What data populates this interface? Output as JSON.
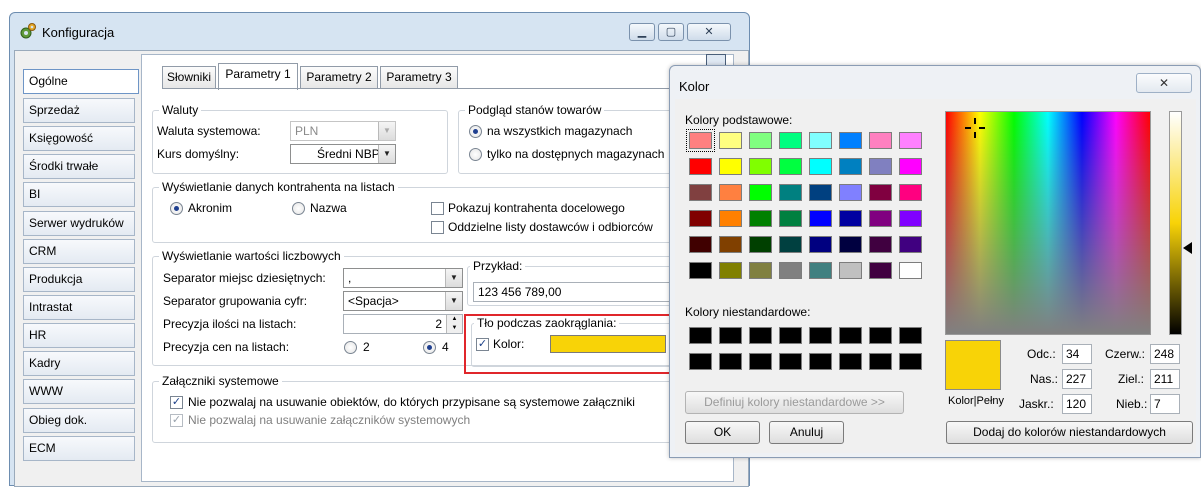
{
  "window": {
    "title": "Konfiguracja"
  },
  "nav": {
    "items": [
      "Ogólne",
      "Sprzedaż",
      "Księgowość",
      "Środki trwałe",
      "BI",
      "Serwer wydruków",
      "CRM",
      "Produkcja",
      "Intrastat",
      "HR",
      "Kadry",
      "WWW",
      "Obieg dok.",
      "ECM"
    ],
    "active": "Ogólne"
  },
  "tabs": [
    "Słowniki",
    "Parametry 1",
    "Parametry 2",
    "Parametry 3"
  ],
  "waluty": {
    "title": "Waluty",
    "system_label": "Waluta systemowa:",
    "system_value": "PLN",
    "course_label": "Kurs domyślny:",
    "course_value": "Średni NBP"
  },
  "stock_preview": {
    "title": "Podgląd stanów towarów",
    "opt_all": "na wszystkich magazynach",
    "opt_available": "tylko na dostępnych magazynach"
  },
  "contractor": {
    "title": "Wyświetlanie danych kontrahenta na listach",
    "opt_acronym": "Akronim",
    "opt_name": "Nazwa",
    "chk_target": "Pokazuj kontrahenta docelowego",
    "chk_separate": "Oddzielne listy dostawców i odbiorców"
  },
  "numbers": {
    "title": "Wyświetlanie wartości liczbowych",
    "decimal_label": "Separator miejsc dziesiętnych:",
    "decimal_value": ",",
    "group_label": "Separator grupowania cyfr:",
    "group_value": "<Spacja>",
    "qty_label": "Precyzja ilości na listach:",
    "qty_value": "2",
    "price_label": "Precyzja cen na listach:",
    "price_opt_2": "2",
    "price_opt_4": "4",
    "example_title": "Przykład:",
    "example_value": "123 456 789,00",
    "rounding_title": "Tło podczas zaokrąglania:",
    "color_label": "Kolor:"
  },
  "attachments": {
    "title": "Załączniki systemowe",
    "chk_objects": "Nie pozwalaj na usuwanie obiektów, do których przypisane są systemowe załączniki",
    "chk_attachments": "Nie pozwalaj na usuwanie załączników systemowych"
  },
  "color_dialog": {
    "title": "Kolor",
    "basic_label": "Kolory podstawowe:",
    "custom_label": "Kolory niestandardowe:",
    "define_button": "Definiuj kolory niestandardowe >>",
    "ok": "OK",
    "cancel": "Anuluj",
    "preview_label": "Kolor|Pełny",
    "hue_label": "Odc.:",
    "hue": "34",
    "sat_label": "Nas.:",
    "sat": "227",
    "lum_label": "Jaskr.:",
    "lum": "120",
    "red_label": "Czerw.:",
    "red": "248",
    "green_label": "Ziel.:",
    "green": "211",
    "blue_label": "Nieb.:",
    "blue": "7",
    "add_button": "Dodaj do kolorów niestandardowych",
    "selected_color": "#f8d307",
    "basic_colors": [
      [
        "#ff8080",
        "#ffff80",
        "#80ff80",
        "#00ff80",
        "#80ffff",
        "#0080ff",
        "#ff80c0",
        "#ff80ff"
      ],
      [
        "#ff0000",
        "#ffff00",
        "#80ff00",
        "#00ff40",
        "#00ffff",
        "#0080c0",
        "#8080c0",
        "#ff00ff"
      ],
      [
        "#804040",
        "#ff8040",
        "#00ff00",
        "#008080",
        "#004080",
        "#8080ff",
        "#800040",
        "#ff0080"
      ],
      [
        "#800000",
        "#ff8000",
        "#008000",
        "#008040",
        "#0000ff",
        "#0000a0",
        "#800080",
        "#8000ff"
      ],
      [
        "#400000",
        "#804000",
        "#004000",
        "#004040",
        "#000080",
        "#000040",
        "#400040",
        "#400080"
      ],
      [
        "#000000",
        "#808000",
        "#808040",
        "#808080",
        "#408080",
        "#c0c0c0",
        "#400040",
        "#ffffff"
      ]
    ],
    "custom_colors": [
      [
        "#000000",
        "#000000",
        "#000000",
        "#000000",
        "#000000",
        "#000000",
        "#000000",
        "#000000"
      ],
      [
        "#000000",
        "#000000",
        "#000000",
        "#000000",
        "#000000",
        "#000000",
        "#000000",
        "#000000"
      ]
    ]
  },
  "highlight_color": "#e0262b"
}
